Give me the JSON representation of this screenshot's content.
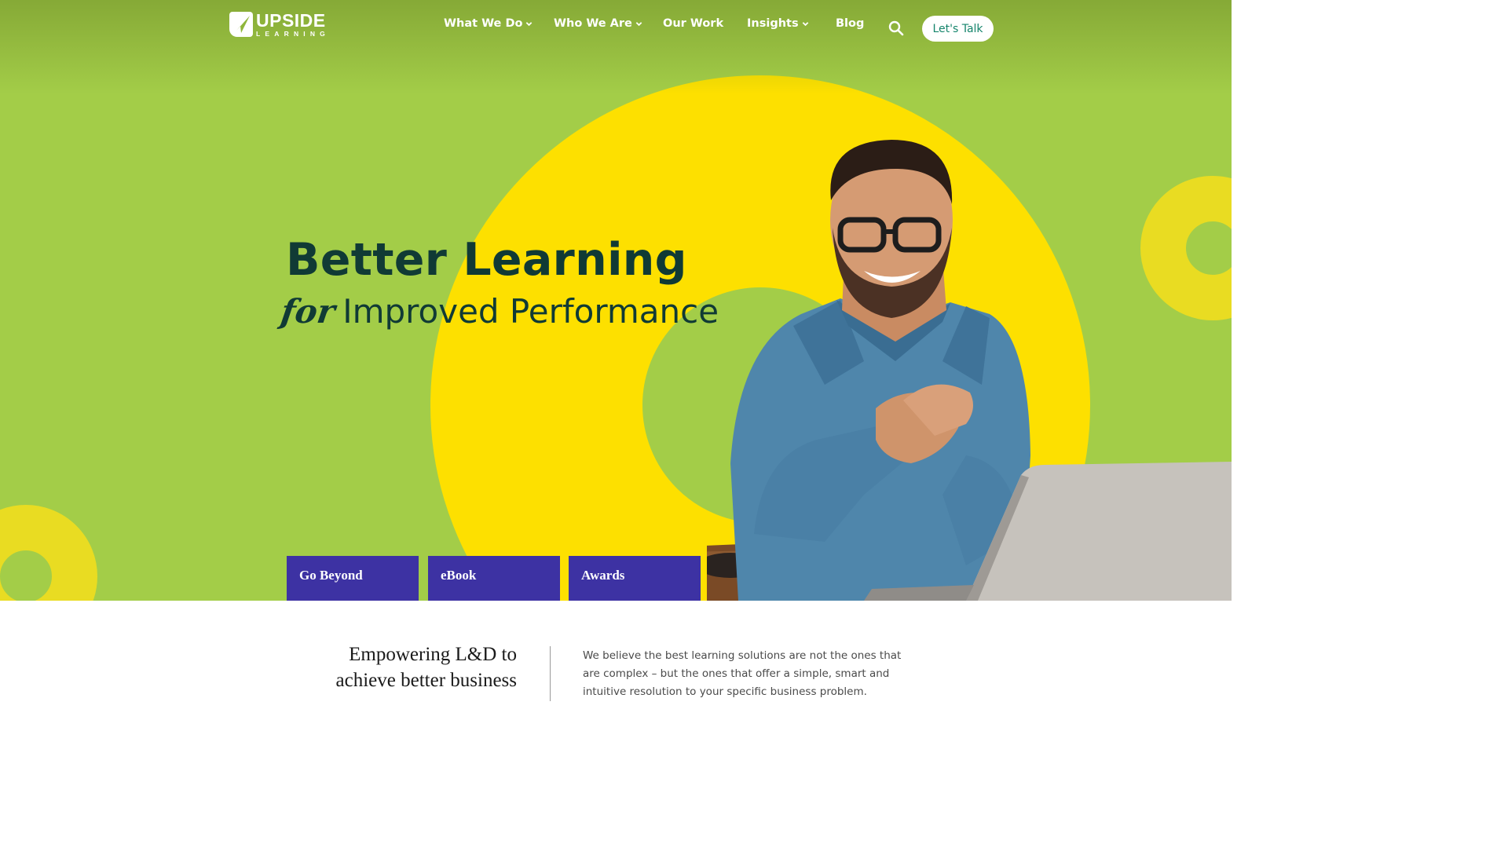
{
  "nav": {
    "logo_main": "UPSIDE",
    "logo_sub": "LEARNING",
    "items": [
      {
        "label": "What We Do",
        "has_dropdown": true
      },
      {
        "label": "Who We Are",
        "has_dropdown": true
      },
      {
        "label": "Our Work",
        "has_dropdown": false
      },
      {
        "label": "Insights",
        "has_dropdown": true
      },
      {
        "label": "Blog",
        "has_dropdown": false
      }
    ],
    "search_icon": "search-icon",
    "cta_label": "Let's Talk"
  },
  "hero": {
    "headline": "Better Learning",
    "sub_for": "for",
    "sub_rest": "Improved Performance",
    "tabs": [
      "Go Beyond",
      "eBook",
      "Awards"
    ]
  },
  "intro": {
    "title_line1": "Empowering L&D to",
    "title_line2": "achieve better business",
    "body": "We believe the best learning solutions are not the ones that are complex – but the ones that offer a simple, smart and intuitive resolution to your specific business problem."
  },
  "colors": {
    "hero_green": "#a3cd48",
    "accent_yellow": "#fde000",
    "tab_purple": "#3d32a3",
    "headline_dark": "#103a35",
    "cta_text": "#16856c"
  }
}
